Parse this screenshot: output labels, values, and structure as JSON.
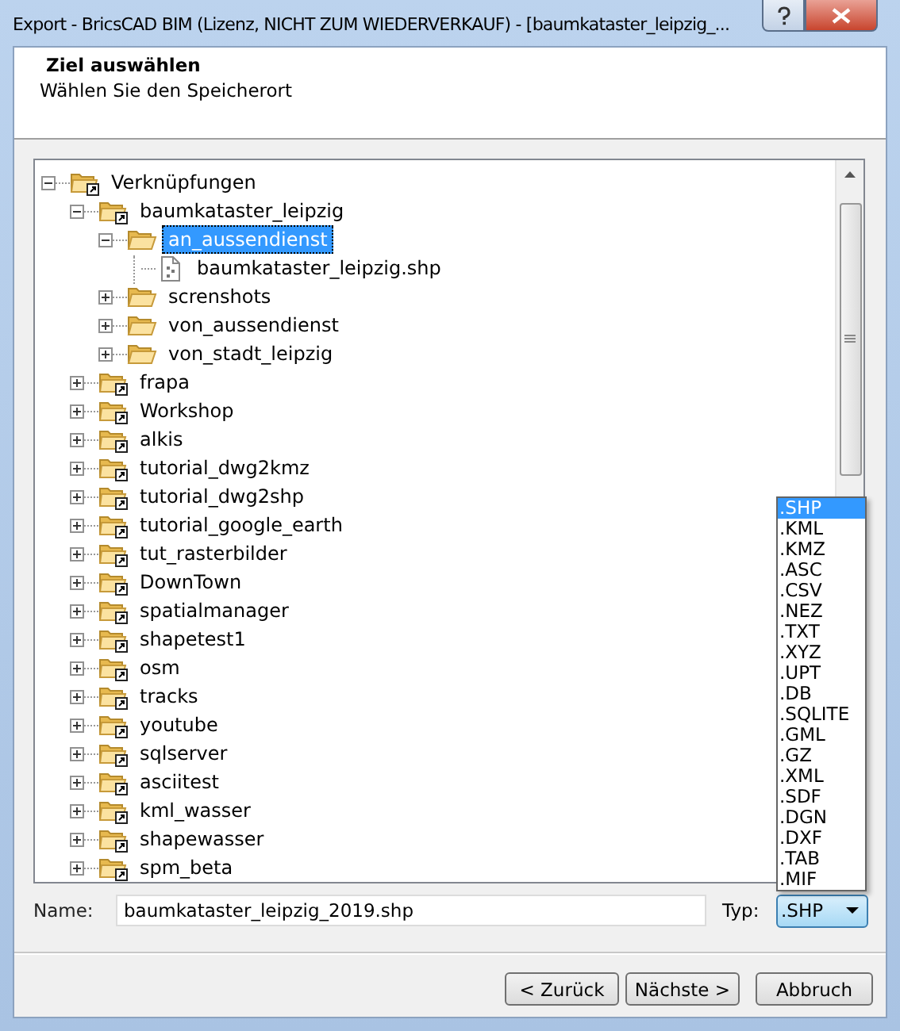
{
  "window": {
    "title": "Export - BricsCAD BIM (Lizenz, NICHT ZUM WIEDERVERKAUF) - [baumkataster_leipzig_..."
  },
  "header": {
    "title": "Ziel auswählen",
    "subtitle": "Wählen Sie den Speicherort"
  },
  "tree": [
    {
      "label": "Verknüpfungen",
      "kind": "shortcut",
      "expanded": true,
      "selected": false,
      "children": [
        {
          "label": "baumkataster_leipzig",
          "kind": "shortcut",
          "expanded": true,
          "selected": false,
          "children": [
            {
              "label": "an_aussendienst",
              "kind": "folder",
              "expanded": true,
              "selected": true,
              "children": [
                {
                  "label": "baumkataster_leipzig.shp",
                  "kind": "file",
                  "selected": false
                }
              ]
            },
            {
              "label": "screnshots",
              "kind": "folder",
              "expanded": false,
              "selected": false
            },
            {
              "label": "von_aussendienst",
              "kind": "folder",
              "expanded": false,
              "selected": false
            },
            {
              "label": "von_stadt_leipzig",
              "kind": "folder",
              "expanded": false,
              "selected": false
            }
          ]
        },
        {
          "label": "frapa",
          "kind": "shortcut",
          "expanded": false,
          "selected": false
        },
        {
          "label": "Workshop",
          "kind": "shortcut",
          "expanded": false,
          "selected": false
        },
        {
          "label": "alkis",
          "kind": "shortcut",
          "expanded": false,
          "selected": false
        },
        {
          "label": "tutorial_dwg2kmz",
          "kind": "shortcut",
          "expanded": false,
          "selected": false
        },
        {
          "label": "tutorial_dwg2shp",
          "kind": "shortcut",
          "expanded": false,
          "selected": false
        },
        {
          "label": "tutorial_google_earth",
          "kind": "shortcut",
          "expanded": false,
          "selected": false
        },
        {
          "label": "tut_rasterbilder",
          "kind": "shortcut",
          "expanded": false,
          "selected": false
        },
        {
          "label": "DownTown",
          "kind": "shortcut",
          "expanded": false,
          "selected": false
        },
        {
          "label": "spatialmanager",
          "kind": "shortcut",
          "expanded": false,
          "selected": false
        },
        {
          "label": "shapetest1",
          "kind": "shortcut",
          "expanded": false,
          "selected": false
        },
        {
          "label": "osm",
          "kind": "shortcut",
          "expanded": false,
          "selected": false
        },
        {
          "label": "tracks",
          "kind": "shortcut",
          "expanded": false,
          "selected": false
        },
        {
          "label": "youtube",
          "kind": "shortcut",
          "expanded": false,
          "selected": false
        },
        {
          "label": "sqlserver",
          "kind": "shortcut",
          "expanded": false,
          "selected": false
        },
        {
          "label": "asciitest",
          "kind": "shortcut",
          "expanded": false,
          "selected": false
        },
        {
          "label": "kml_wasser",
          "kind": "shortcut",
          "expanded": false,
          "selected": false
        },
        {
          "label": "shapewasser",
          "kind": "shortcut",
          "expanded": false,
          "selected": false
        },
        {
          "label": "spm_beta",
          "kind": "shortcut",
          "expanded": false,
          "selected": false
        }
      ]
    }
  ],
  "name_field": {
    "label": "Name:",
    "value": "baumkataster_leipzig_2019.shp"
  },
  "type_field": {
    "label": "Typ:",
    "value": ".SHP"
  },
  "type_options": [
    {
      "label": ".SHP",
      "selected": true
    },
    {
      "label": ".KML",
      "selected": false
    },
    {
      "label": ".KMZ",
      "selected": false
    },
    {
      "label": ".ASC",
      "selected": false
    },
    {
      "label": ".CSV",
      "selected": false
    },
    {
      "label": ".NEZ",
      "selected": false
    },
    {
      "label": ".TXT",
      "selected": false
    },
    {
      "label": ".XYZ",
      "selected": false
    },
    {
      "label": ".UPT",
      "selected": false
    },
    {
      "label": ".DB",
      "selected": false
    },
    {
      "label": ".SQLITE",
      "selected": false
    },
    {
      "label": ".GML",
      "selected": false
    },
    {
      "label": ".GZ",
      "selected": false
    },
    {
      "label": ".XML",
      "selected": false
    },
    {
      "label": ".SDF",
      "selected": false
    },
    {
      "label": ".DGN",
      "selected": false
    },
    {
      "label": ".DXF",
      "selected": false
    },
    {
      "label": ".TAB",
      "selected": false
    },
    {
      "label": ".MIF",
      "selected": false
    }
  ],
  "buttons": [
    "< Zurück",
    "Nächste >",
    "Abbruch"
  ]
}
